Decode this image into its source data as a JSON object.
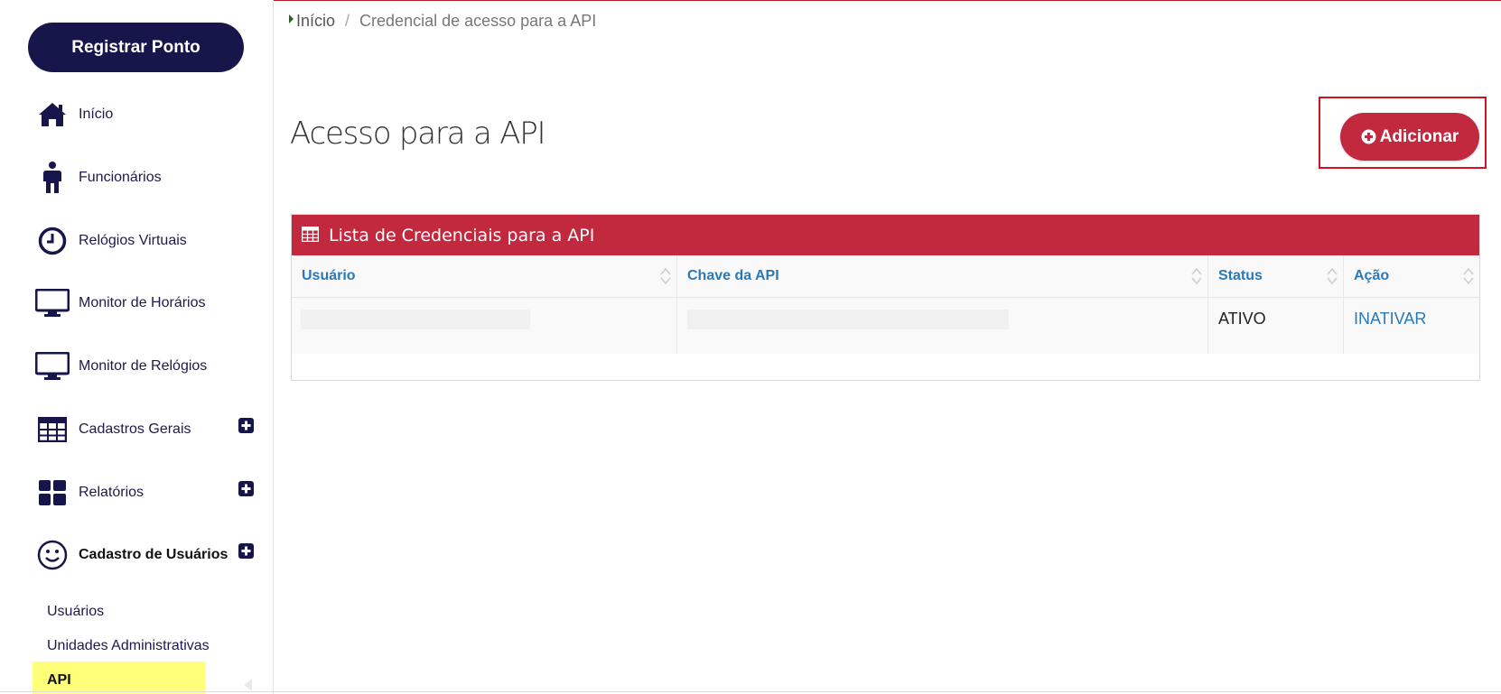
{
  "sidebar": {
    "register_button": "Registrar Ponto",
    "items": [
      {
        "label": "Início",
        "icon": "home-icon"
      },
      {
        "label": "Funcionários",
        "icon": "person-icon"
      },
      {
        "label": "Relógios Virtuais",
        "icon": "clock-icon"
      },
      {
        "label": "Monitor de Horários",
        "icon": "monitor-icon"
      },
      {
        "label": "Monitor de Relógios",
        "icon": "monitor-icon"
      },
      {
        "label": "Cadastros Gerais",
        "icon": "table-icon",
        "expand": "plus-square-icon"
      },
      {
        "label": "Relatórios",
        "icon": "dashboard-icon",
        "expand": "plus-square-icon"
      },
      {
        "label": "Cadastro de Usuários",
        "icon": "smiley-icon",
        "expand": "plus-square-icon"
      }
    ],
    "subitems": [
      "Usuários",
      "Unidades Administrativas",
      "API"
    ],
    "active_subitem_color": "#ffff7a"
  },
  "breadcrumb": {
    "home": "Início",
    "separator": "/",
    "current": "Credencial de acesso para a API"
  },
  "page": {
    "title": "Acesso para a API",
    "add_button": "Adicionar"
  },
  "panel": {
    "title": "Lista de Credenciais para a API",
    "columns": [
      "Usuário",
      "Chave da API",
      "Status",
      "Ação"
    ],
    "rows": [
      {
        "user": "",
        "key": "",
        "status": "ATIVO",
        "action": "INATIVAR"
      }
    ]
  },
  "colors": {
    "brand_dark": "#17164a",
    "accent_red": "#c2283e",
    "link_blue": "#2b78b8"
  }
}
